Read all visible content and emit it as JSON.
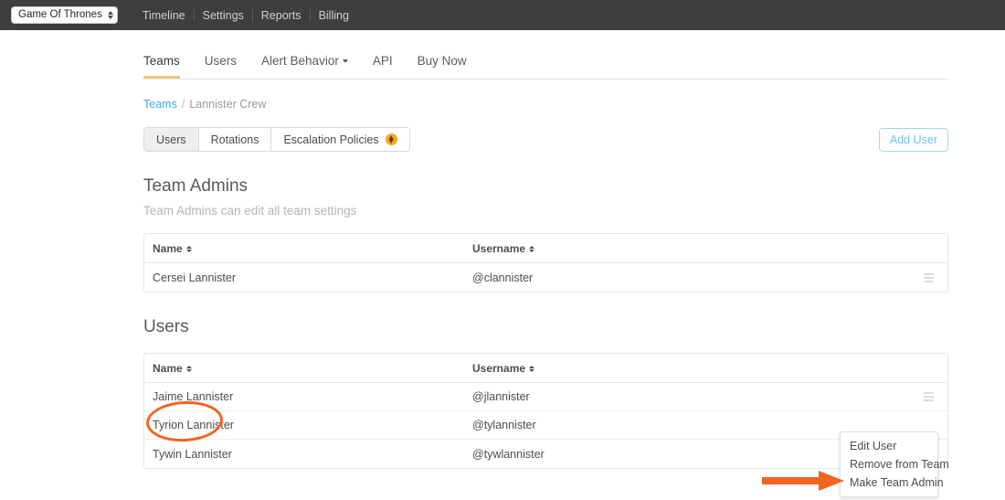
{
  "navbar": {
    "org_select": "Game Of Thrones",
    "links": [
      "Timeline",
      "Settings",
      "Reports",
      "Billing"
    ]
  },
  "section_tabs": [
    {
      "label": "Teams",
      "active": true,
      "caret": false
    },
    {
      "label": "Users",
      "active": false,
      "caret": false
    },
    {
      "label": "Alert Behavior",
      "active": false,
      "caret": true
    },
    {
      "label": "API",
      "active": false,
      "caret": false
    },
    {
      "label": "Buy Now",
      "active": false,
      "caret": false
    }
  ],
  "breadcrumb": {
    "root": "Teams",
    "separator": "/",
    "current": "Lannister Crew"
  },
  "pill_tabs": [
    {
      "label": "Users",
      "active": true,
      "badge": false
    },
    {
      "label": "Rotations",
      "active": false,
      "badge": false
    },
    {
      "label": "Escalation Policies",
      "active": false,
      "badge": true
    }
  ],
  "add_user_button": "Add User",
  "team_admins": {
    "title": "Team Admins",
    "subtitle": "Team Admins can edit all team settings",
    "columns": [
      "Name",
      "Username"
    ],
    "rows": [
      {
        "name": "Cersei Lannister",
        "username": "@clannister"
      }
    ]
  },
  "users": {
    "title": "Users",
    "columns": [
      "Name",
      "Username"
    ],
    "rows": [
      {
        "name": "Jaime Lannister",
        "username": "@jlannister"
      },
      {
        "name": "Tyrion Lannister",
        "username": "@tylannister"
      },
      {
        "name": "Tywin Lannister",
        "username": "@tywlannister"
      }
    ]
  },
  "dropdown_menu": {
    "items": [
      "Edit User",
      "Remove from Team",
      "Make Team Admin"
    ]
  },
  "colors": {
    "navbar_bg": "#3e3e3e",
    "accent_orange": "#f26522",
    "badge_orange": "#f5a623",
    "tab_underline": "#f7c777",
    "link_blue": "#3aaed8",
    "button_blue": "#6ec6e8"
  }
}
